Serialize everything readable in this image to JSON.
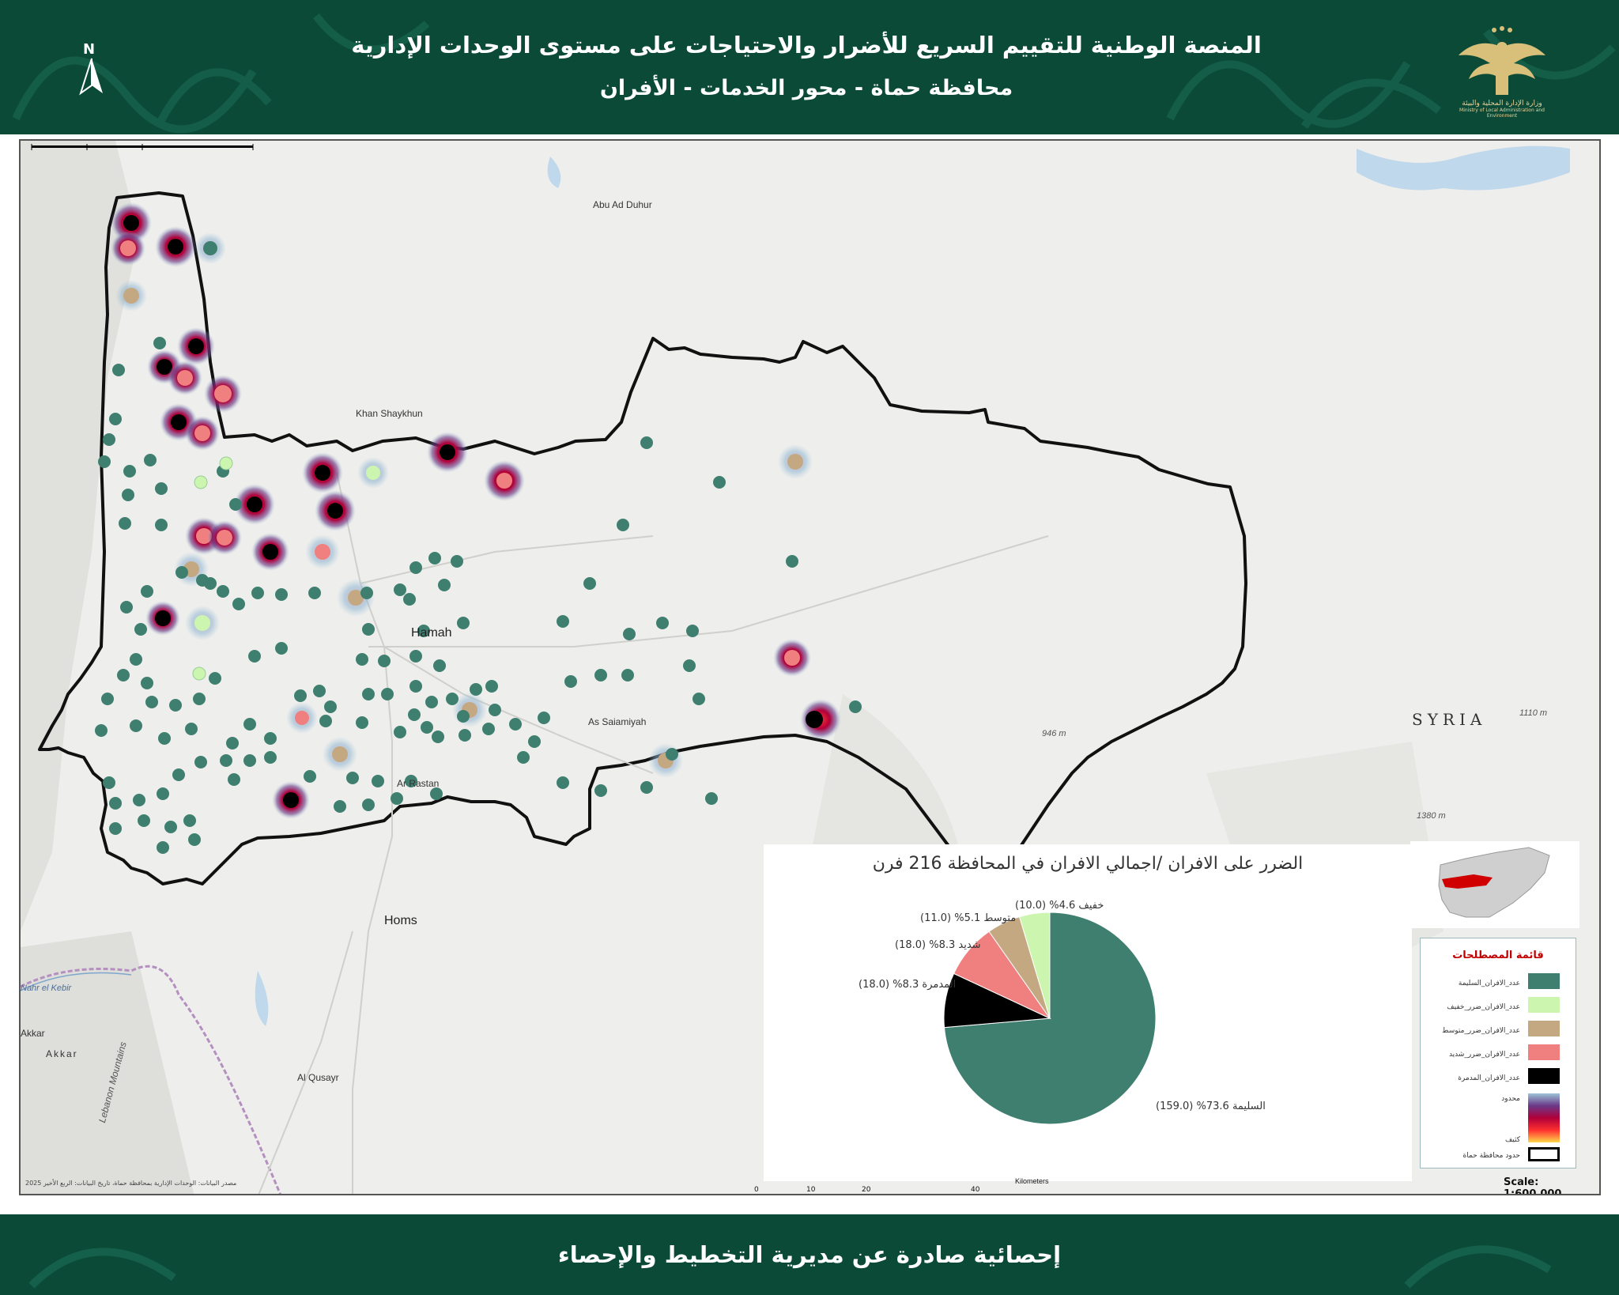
{
  "header": {
    "title_line1": "المنصة الوطنية للتقييم السريع للأضرار والاحتياجات على مستوى الوحدات الإدارية",
    "title_line2": "محافظة حماة  - محور الخدمات - الأفران",
    "north_label": "N",
    "logo_caption": "وزارة الإدارة المحلية والبيئة",
    "logo_caption_en": "Ministry of Local Administration and Environment"
  },
  "map": {
    "places": {
      "abu_ad_duhur": "Abu Ad Duhur",
      "khan_shaykhun": "Khan Shaykhun",
      "hamah": "Hamah",
      "as_salamiyah": "As Saiamiyah",
      "rastan": "Ar Rastan",
      "homs": "Homs",
      "al_qusayr": "Al Qusayr",
      "akkar": "Akkar",
      "akkar2": "Akkar",
      "nahr_el_kebir": "Nahr el Kebir",
      "lebanon_mountains": "Lebanon Mountains",
      "syria": "SYRIA"
    },
    "elevations": {
      "e946": "946 m",
      "e1110": "1110 m",
      "e1380": "1380 m"
    },
    "scale_label": "Scale: 1:600,000",
    "scalebar": {
      "unit": "Kilometers",
      "ticks": [
        "0",
        "10",
        "20",
        "40"
      ]
    },
    "credit": "مصدر البيانات: الوحدات الإدارية بمحافظة حماة، تاريخ البيانات: الربع الأخير 2025"
  },
  "chart_data": {
    "type": "pie",
    "title": "الضرر على الافران /اجمالي الافران في المحافظة 216 فرن",
    "total": 216,
    "slices": [
      {
        "name": "السليمة",
        "value": 159.0,
        "percent": 73.6,
        "color": "#3f7f6f",
        "label": "السليمة 73.6% (159.0)"
      },
      {
        "name": "المدمرة",
        "value": 18.0,
        "percent": 8.3,
        "color": "#000000",
        "label": "المدمرة 8.3% (18.0)"
      },
      {
        "name": "شديد",
        "value": 18.0,
        "percent": 8.3,
        "color": "#f08080",
        "label": "شديد 8.3% (18.0)"
      },
      {
        "name": "متوسط",
        "value": 11.0,
        "percent": 5.1,
        "color": "#c4a882",
        "label": "متوسط 5.1% (11.0)"
      },
      {
        "name": "خفيف",
        "value": 10.0,
        "percent": 4.6,
        "color": "#ccf5b0",
        "label": "خفيف 4.6% (10.0)"
      }
    ]
  },
  "legend": {
    "title": "قائمة المصطلحات",
    "items": [
      {
        "label": "عدد_الافران_السليمة",
        "color": "#3f7f6f"
      },
      {
        "label": "عدد_الافران_ضرر_خفيف",
        "color": "#ccf5b0"
      },
      {
        "label": "عدد_الافران_ضرر_متوسط",
        "color": "#c4a882"
      },
      {
        "label": "عدد_الافران_ضرر_شديد",
        "color": "#f08080"
      },
      {
        "label": "عدد_الافران_المدمرة",
        "color": "#000000"
      }
    ],
    "density_low": "محدود",
    "density_high": "كثيف",
    "boundary_label": "حدود محافظة حماة"
  },
  "footer": {
    "text": "إحصائية صادرة عن مديرية التخطيط والإحصاء"
  }
}
